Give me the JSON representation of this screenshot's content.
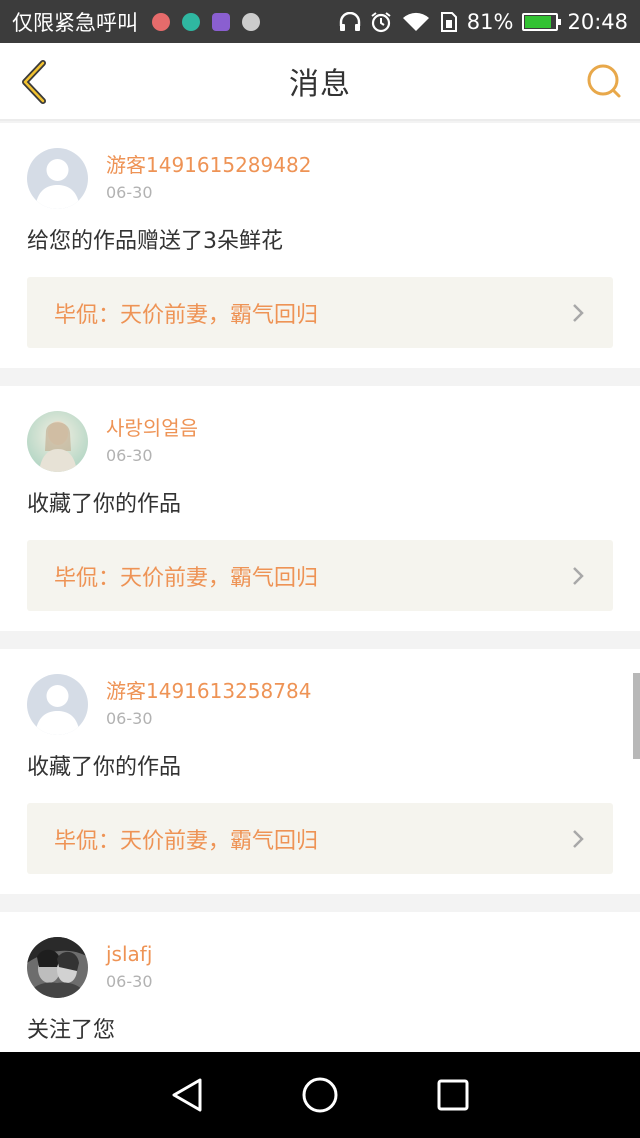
{
  "status_bar": {
    "carrier": "仅限紧急呼叫",
    "battery_percent": "81%",
    "battery_level": 0.81,
    "time": "20:48",
    "app_icon_colors": [
      "#e66b6b",
      "#2fb7a1",
      "#8a5fd0",
      "#cccccc"
    ]
  },
  "header": {
    "title": "消息",
    "back_icon": "chevron-left-icon",
    "search_icon": "search-icon",
    "accent": "#e8a84a"
  },
  "messages": [
    {
      "user": "游客1491615289482",
      "date": "06-30",
      "action": "给您的作品赠送了3朵鲜花",
      "work": "毕侃：天价前妻，霸气回归",
      "avatar": "default"
    },
    {
      "user": "사랑의얼음",
      "date": "06-30",
      "action": "收藏了你的作品",
      "work": "毕侃：天价前妻，霸气回归",
      "avatar": "photo-girl"
    },
    {
      "user": "游客1491613258784",
      "date": "06-30",
      "action": "收藏了你的作品",
      "work": "毕侃：天价前妻，霸气回归",
      "avatar": "default"
    },
    {
      "user": "jslafj",
      "date": "06-30",
      "action": "关注了您",
      "work": "",
      "avatar": "photo-couple"
    }
  ],
  "colors": {
    "username": "#ee9355",
    "work_title": "#ee9355",
    "work_bg": "#f5f4ee"
  },
  "nav": {
    "back": "nav-back-icon",
    "home": "nav-home-icon",
    "recents": "nav-recents-icon"
  }
}
